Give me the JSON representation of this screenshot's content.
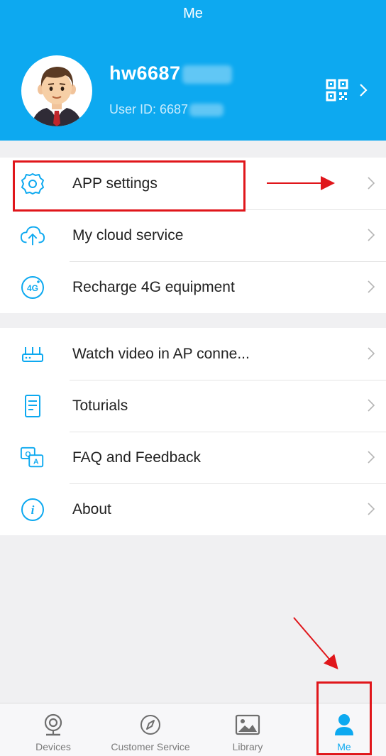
{
  "header": {
    "title": "Me",
    "username": "hw6687",
    "user_id": "User ID: 6687"
  },
  "menu": {
    "group1": [
      {
        "label": "APP settings",
        "icon": "gear-icon"
      },
      {
        "label": "My cloud service",
        "icon": "cloud-upload-icon"
      },
      {
        "label": "Recharge 4G equipment",
        "icon": "4g-icon"
      }
    ],
    "group2": [
      {
        "label": "Watch video in AP conne...",
        "icon": "router-icon"
      },
      {
        "label": "Toturials",
        "icon": "document-icon"
      },
      {
        "label": "FAQ and Feedback",
        "icon": "faq-icon"
      },
      {
        "label": "About",
        "icon": "info-icon"
      }
    ]
  },
  "tabbar": {
    "tabs": [
      {
        "label": "Devices",
        "icon": "camera-icon"
      },
      {
        "label": "Customer Service",
        "icon": "compass-icon"
      },
      {
        "label": "Library",
        "icon": "image-icon"
      },
      {
        "label": "Me",
        "icon": "person-icon",
        "active": true
      }
    ]
  },
  "colors": {
    "accent": "#0da9f0",
    "annotation": "#e0161b"
  }
}
